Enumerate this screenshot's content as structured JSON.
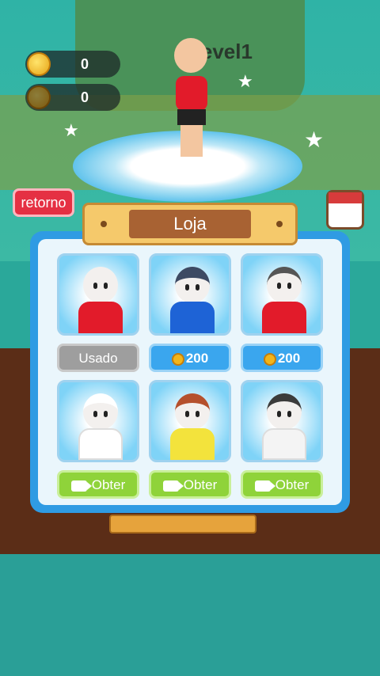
{
  "hud": {
    "coins": "0",
    "gems": "0",
    "level": "Level1"
  },
  "nav": {
    "back_label": "retorno"
  },
  "shop": {
    "title": "Loja",
    "skins": [
      {
        "name": "red-shirt",
        "shirt_color": "#e21b2a",
        "button": {
          "type": "used",
          "label": "Usado"
        }
      },
      {
        "name": "blue-shirt-helmet",
        "shirt_color": "#1e63d6",
        "button": {
          "type": "price",
          "label": "200"
        }
      },
      {
        "name": "red-shirt-headband",
        "shirt_color": "#e21b2a",
        "button": {
          "type": "price",
          "label": "200"
        }
      },
      {
        "name": "chef",
        "shirt_color": "#ffffff",
        "button": {
          "type": "video",
          "label": "Obter"
        }
      },
      {
        "name": "yellow-tank",
        "shirt_color": "#f3e33c",
        "button": {
          "type": "video",
          "label": "Obter"
        }
      },
      {
        "name": "white-cap",
        "shirt_color": "#f4f4f4",
        "button": {
          "type": "video",
          "label": "Obter"
        }
      }
    ]
  },
  "colors": {
    "accent_blue": "#2f9be3",
    "back_red": "#e53043",
    "obter_green": "#8fd33a"
  }
}
